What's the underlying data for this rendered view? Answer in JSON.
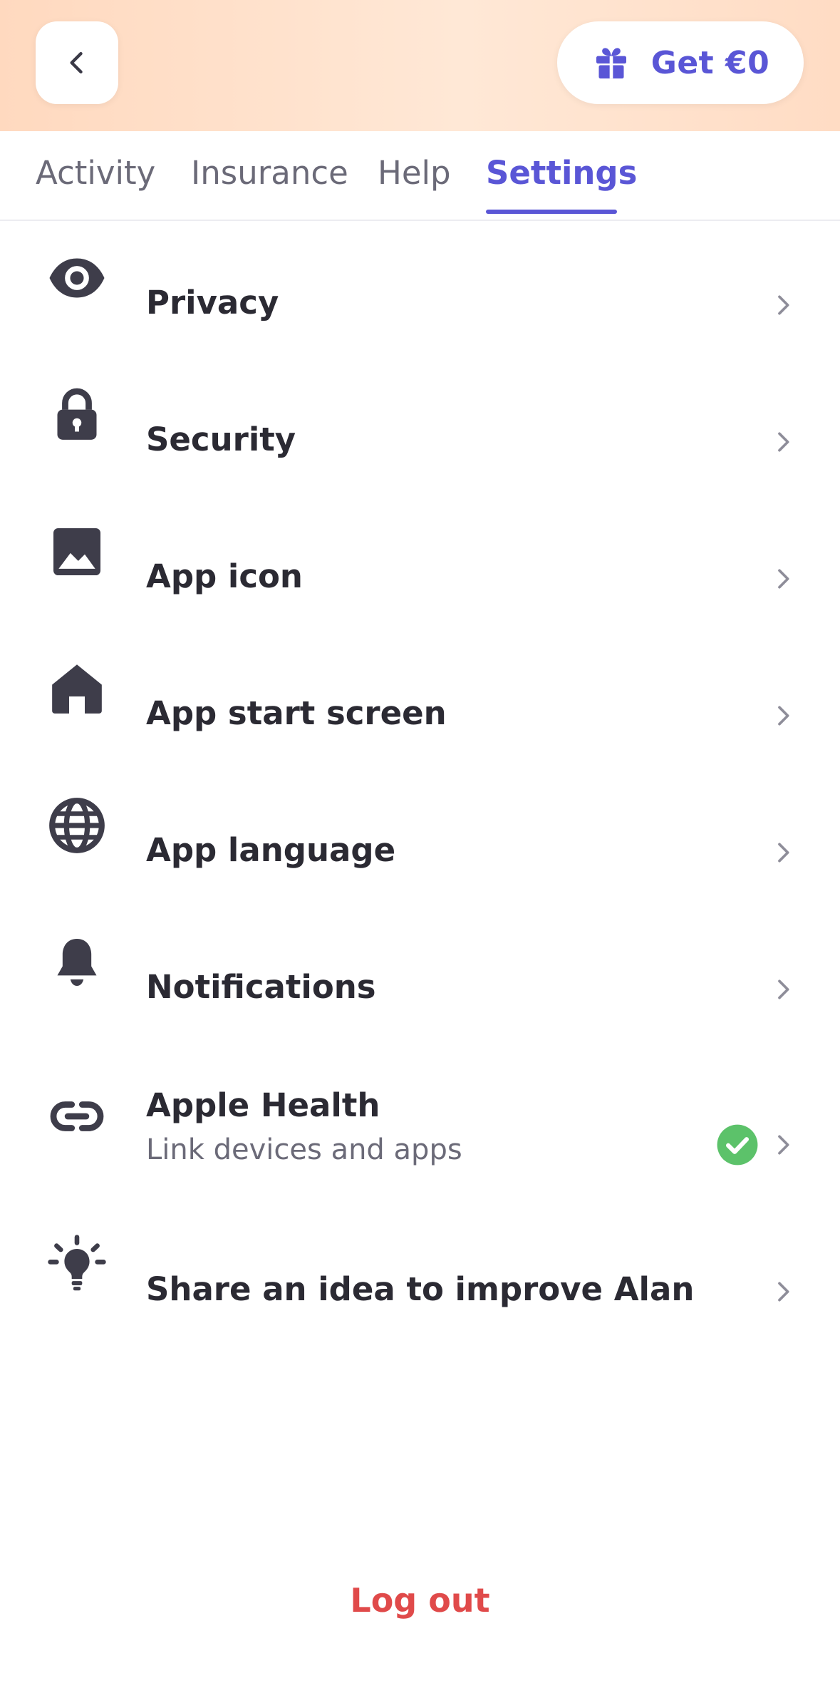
{
  "header": {
    "back_icon": "chevron-left-icon",
    "referral": {
      "icon": "gift-icon",
      "label": "Get €0",
      "color": "#5a56d6"
    }
  },
  "tabs": [
    {
      "label": "Activity",
      "active": false
    },
    {
      "label": "Insurance",
      "active": false
    },
    {
      "label": "Help",
      "active": false
    },
    {
      "label": "Settings",
      "active": true
    }
  ],
  "settings": {
    "items": [
      {
        "icon": "eye-icon",
        "title": "Privacy"
      },
      {
        "icon": "lock-icon",
        "title": "Security"
      },
      {
        "icon": "image-icon",
        "title": "App icon"
      },
      {
        "icon": "home-icon",
        "title": "App start screen"
      },
      {
        "icon": "globe-icon",
        "title": "App language"
      },
      {
        "icon": "bell-icon",
        "title": "Notifications"
      },
      {
        "icon": "link-icon",
        "title": "Apple Health",
        "subtitle": "Link devices and apps",
        "status": "connected",
        "status_icon": "check-circle-icon"
      },
      {
        "icon": "lightbulb-icon",
        "title": "Share an idea to improve Alan"
      }
    ]
  },
  "logout_label": "Log out",
  "colors": {
    "accent": "#5a56d6",
    "danger": "#e04a4a",
    "success": "#5cc26a",
    "text": "#2b2a33",
    "muted": "#6b6a78"
  }
}
